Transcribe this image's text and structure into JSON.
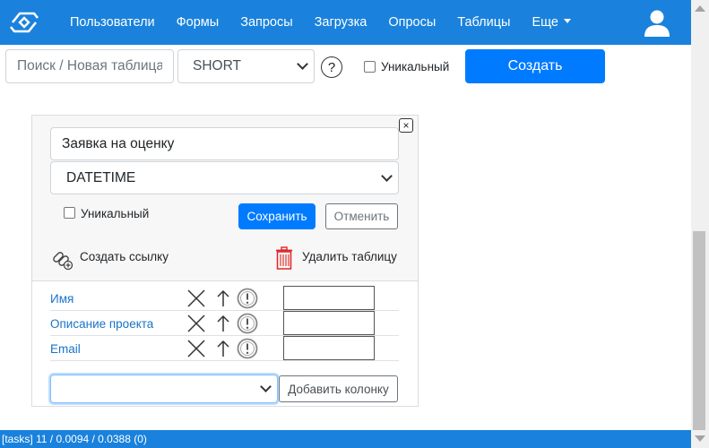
{
  "nav": {
    "items": [
      {
        "label": "Пользователи"
      },
      {
        "label": "Формы"
      },
      {
        "label": "Запросы"
      },
      {
        "label": "Загрузка"
      },
      {
        "label": "Опросы"
      },
      {
        "label": "Таблицы"
      },
      {
        "label": "Еще"
      }
    ]
  },
  "toolbar": {
    "search_placeholder": "Поиск / Новая таблица",
    "type_value": "SHORT",
    "help_glyph": "?",
    "unique_label": "Уникальный",
    "create_label": "Создать"
  },
  "panel": {
    "close_glyph": "×",
    "name_value": "Заявка на оценку",
    "type_value": "DATETIME",
    "unique_label": "Уникальный",
    "save_label": "Сохранить",
    "cancel_label": "Отменить",
    "create_link_label": "Создать ссылку",
    "delete_table_label": "Удалить таблицу",
    "columns": [
      {
        "name": "Имя"
      },
      {
        "name": "Описание проекта"
      },
      {
        "name": "Email"
      }
    ],
    "add_column_label": "Добавить колонку"
  },
  "status": {
    "text": "[tasks] 11 / 0.0094 / 0.0388 (0)"
  },
  "colors": {
    "brand": "#1a82dc",
    "primary": "#007bff",
    "link": "#1a73c8",
    "danger": "#e02424"
  }
}
